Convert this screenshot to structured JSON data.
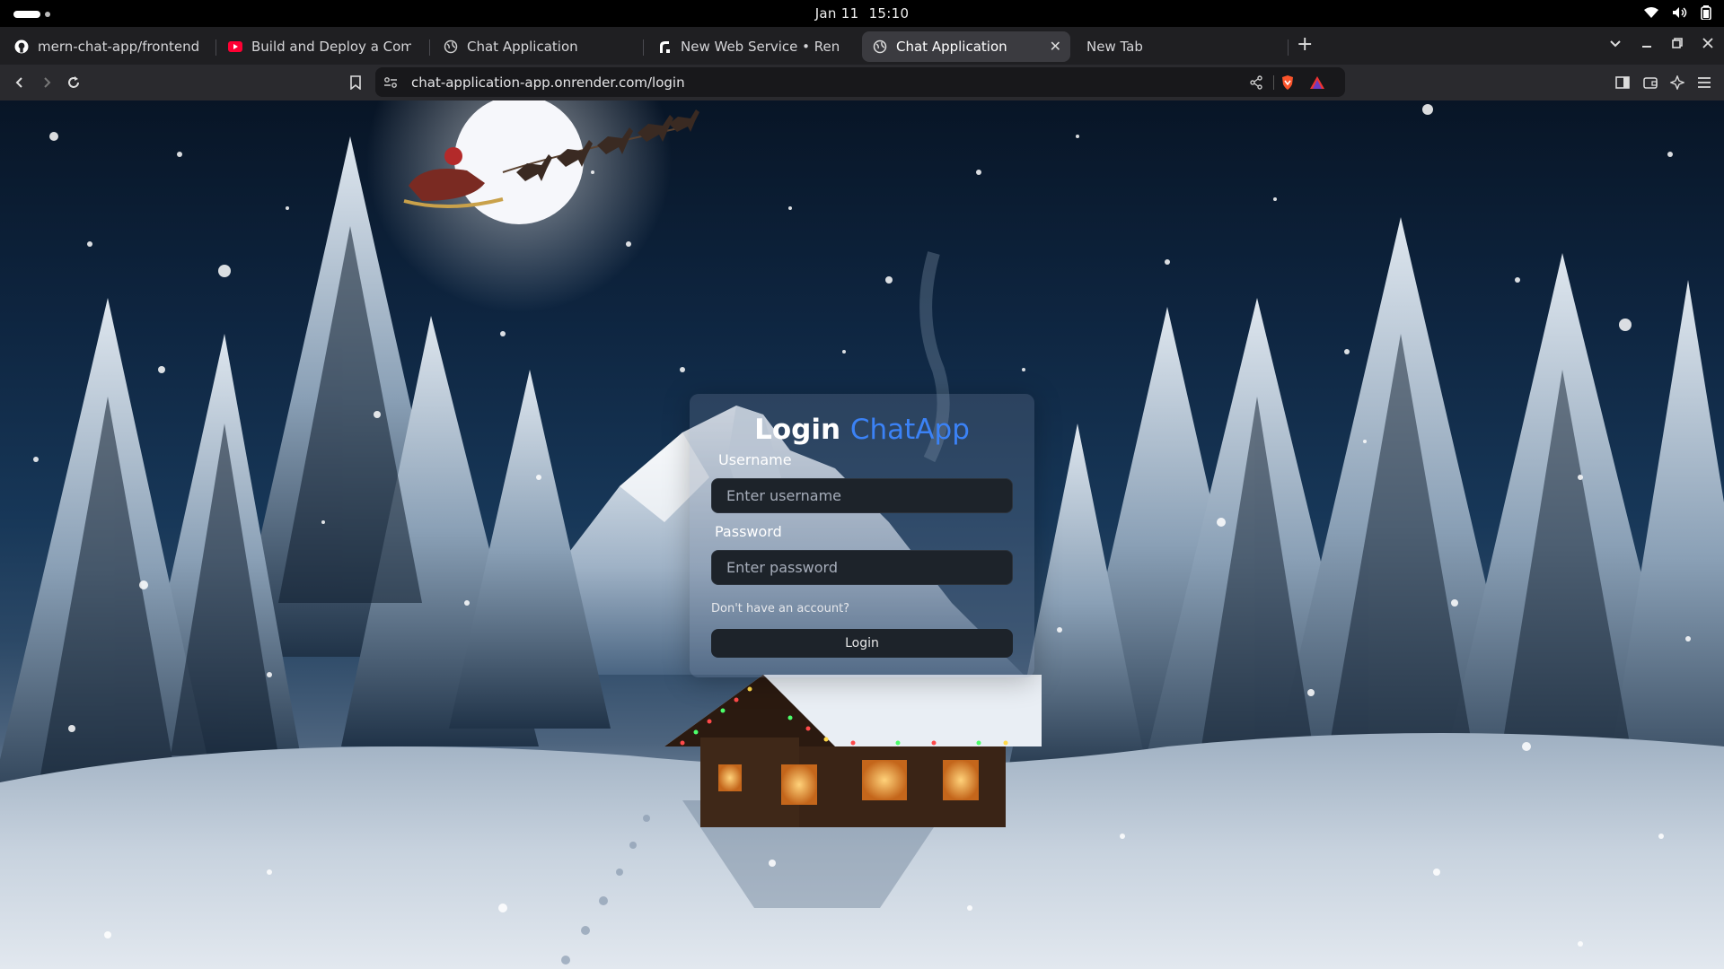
{
  "os": {
    "date": "Jan 11",
    "time": "15:10"
  },
  "tabs": [
    {
      "title": "mern-chat-app/frontend/pa",
      "icon": "github-icon",
      "active": false
    },
    {
      "title": "Build and Deploy a Complete",
      "icon": "youtube-icon",
      "active": false
    },
    {
      "title": "Chat Application",
      "icon": "globe-icon",
      "active": false
    },
    {
      "title": "New Web Service • Render",
      "icon": "render-icon",
      "active": false
    },
    {
      "title": "Chat Application",
      "icon": "globe-icon",
      "active": true
    },
    {
      "title": "New Tab",
      "icon": "",
      "active": false
    }
  ],
  "toolbar": {
    "url": "chat-application-app.onrender.com/login"
  },
  "login": {
    "title_prefix": "Login",
    "title_brand": "ChatApp",
    "username_label": "Username",
    "username_placeholder": "Enter username",
    "password_label": "Password",
    "password_placeholder": "Enter password",
    "signup_link": "Don't have an account?",
    "submit_label": "Login"
  },
  "colors": {
    "accent": "#3b82f6",
    "input_bg": "#1d232a"
  }
}
